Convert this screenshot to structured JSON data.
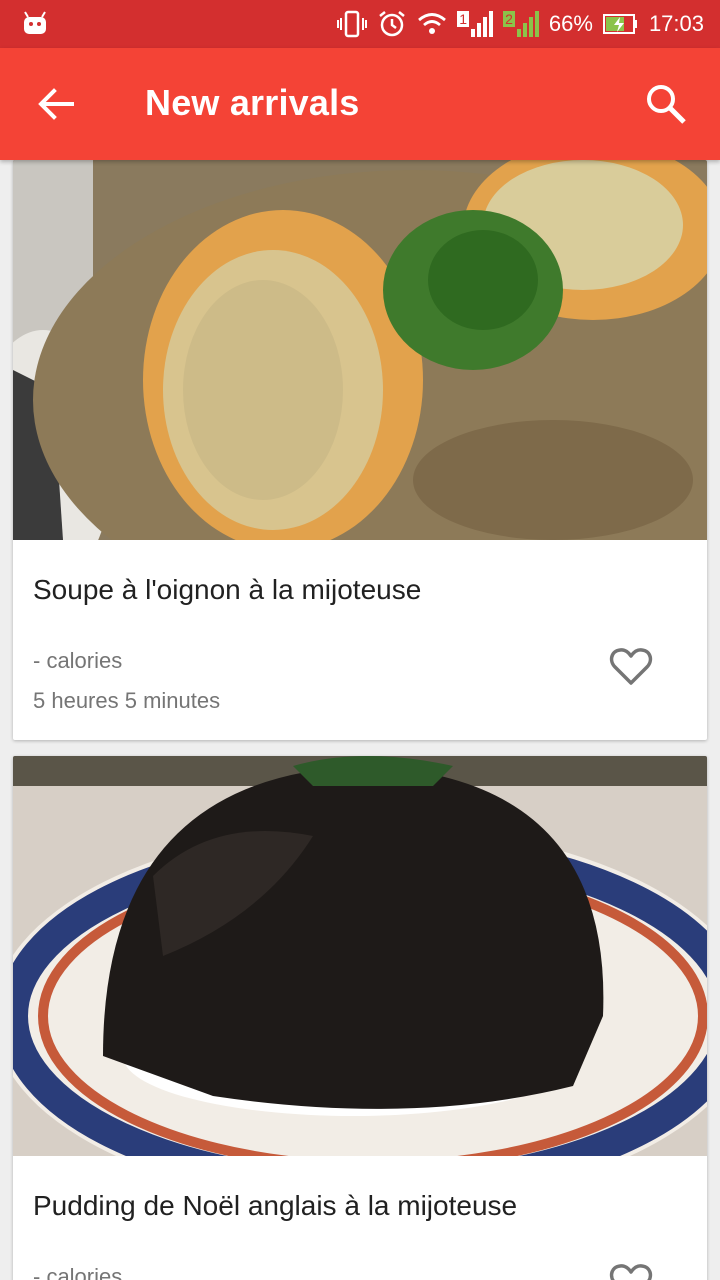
{
  "status_bar": {
    "battery": "66%",
    "time": "17:03",
    "sim1": "1",
    "sim2": "2"
  },
  "app_bar": {
    "title": "New arrivals"
  },
  "recipes": [
    {
      "name": "Soupe à l'oignon à la mijoteuse",
      "calories": "- calories",
      "duration": "5 heures 5 minutes"
    },
    {
      "name": "Pudding de Noël anglais à la mijoteuse",
      "calories": "- calories",
      "duration": ""
    }
  ],
  "colors": {
    "status_bar": "#d32f2f",
    "app_bar": "#f44336"
  }
}
